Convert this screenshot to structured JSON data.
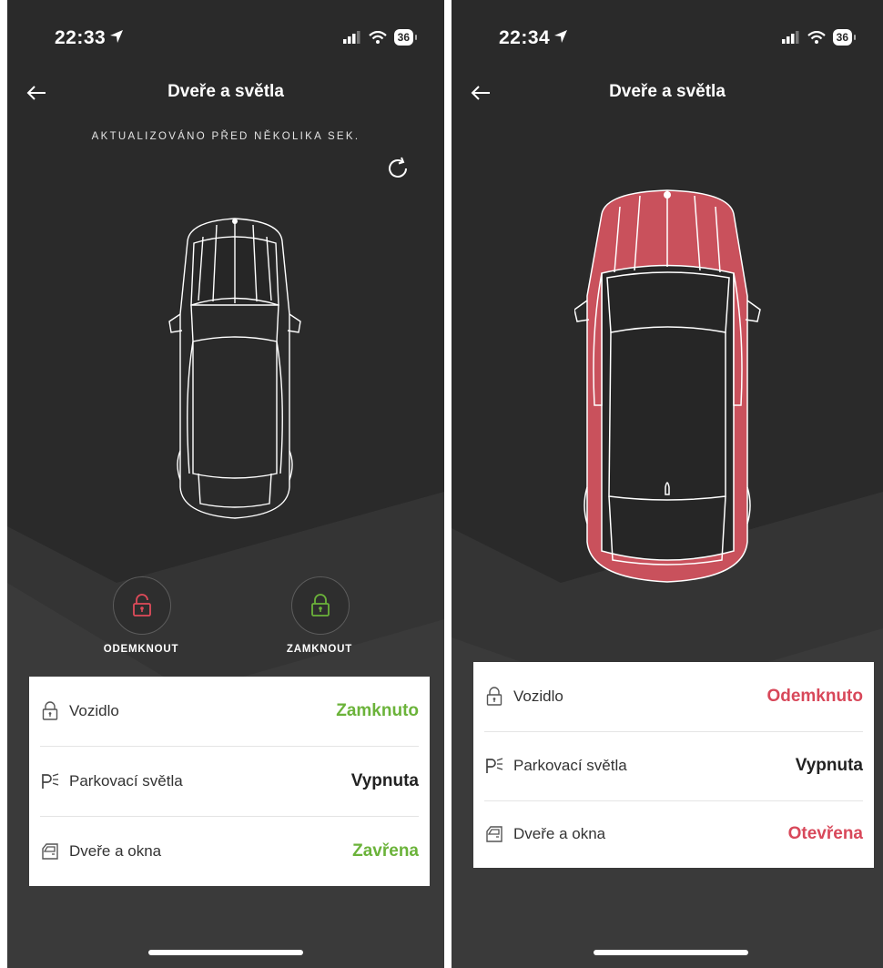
{
  "colors": {
    "background": "#2a2a2a",
    "ok_green": "#6bb33a",
    "alert_red": "#d8485a",
    "neutral": "#222222",
    "car_highlight": "#c9515c"
  },
  "left": {
    "status": {
      "time": "22:33",
      "battery": "36",
      "icons": [
        "location-arrow-icon",
        "signal-icon",
        "wifi-icon",
        "battery-icon"
      ]
    },
    "header": {
      "back_icon": "arrow-left-icon",
      "title": "Dveře a světla"
    },
    "updated_text": "AKTUALIZOVÁNO PŘED NĚKOLIKA SEK.",
    "refresh_icon": "refresh-icon",
    "actions": {
      "unlock_label": "ODEMKNOUT",
      "unlock_icon": "unlock-icon",
      "lock_label": "ZAMKNOUT",
      "lock_icon": "lock-icon"
    },
    "status_rows": [
      {
        "icon": "padlock-icon",
        "label": "Vozidlo",
        "value": "Zamknuto",
        "color": "#6bb33a"
      },
      {
        "icon": "parking-light-icon",
        "label": "Parkovací světla",
        "value": "Vypnuta",
        "color": "#222222"
      },
      {
        "icon": "door-icon",
        "label": "Dveře a okna",
        "value": "Zavřena",
        "color": "#6bb33a"
      }
    ]
  },
  "right": {
    "status": {
      "time": "22:34",
      "battery": "36",
      "icons": [
        "location-arrow-icon",
        "signal-icon",
        "wifi-icon",
        "battery-icon"
      ]
    },
    "header": {
      "back_icon": "arrow-left-icon",
      "title": "Dveře a světla"
    },
    "status_rows": [
      {
        "icon": "padlock-icon",
        "label": "Vozidlo",
        "value": "Odemknuto",
        "color": "#d8485a"
      },
      {
        "icon": "parking-light-icon",
        "label": "Parkovací světla",
        "value": "Vypnuta",
        "color": "#222222"
      },
      {
        "icon": "door-icon",
        "label": "Dveře a okna",
        "value": "Otevřena",
        "color": "#d8485a"
      }
    ]
  }
}
